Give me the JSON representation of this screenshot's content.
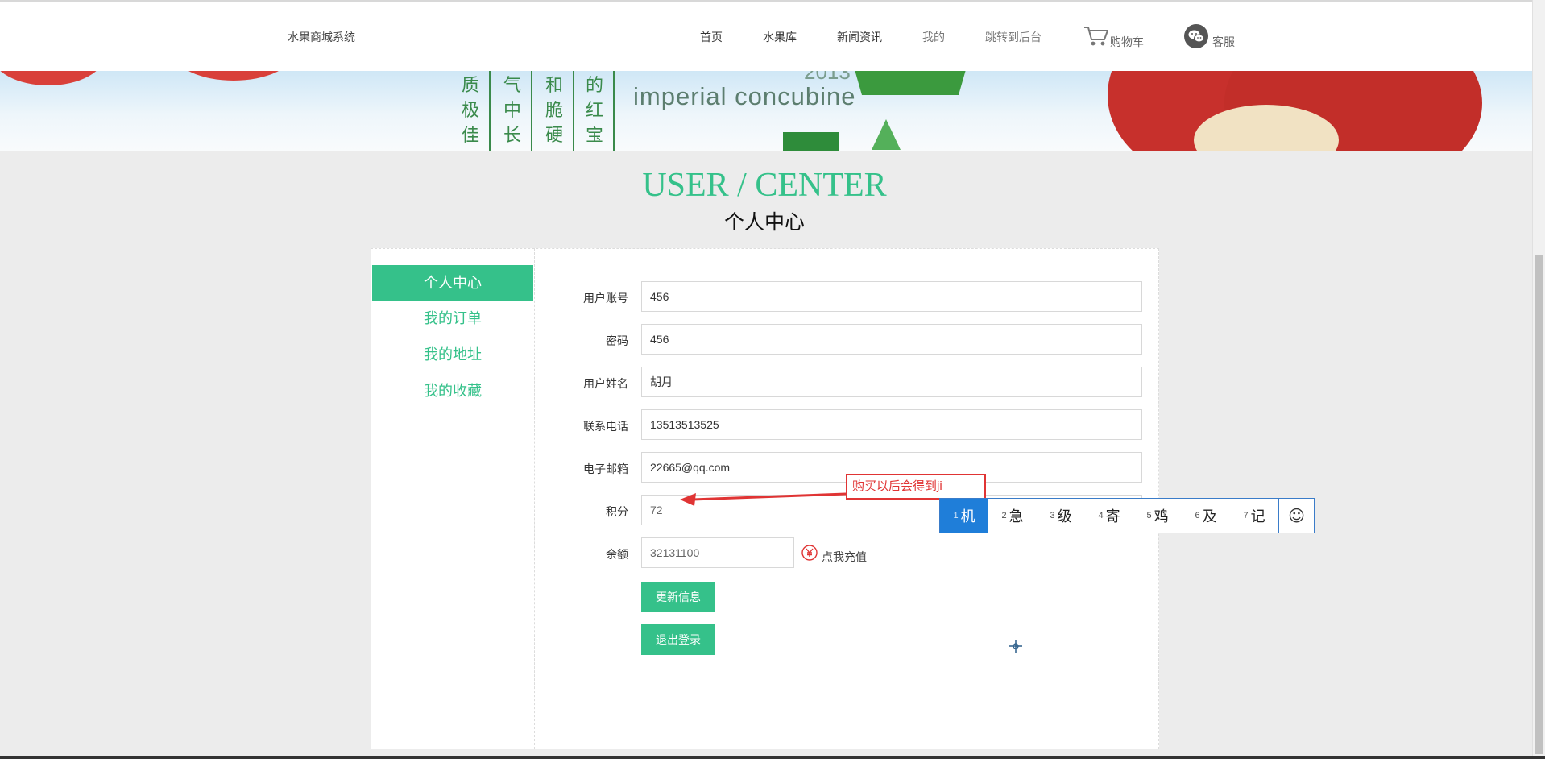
{
  "header": {
    "site_name": "水果商城系统",
    "nav": [
      {
        "label": "首页"
      },
      {
        "label": "水果库"
      },
      {
        "label": "新闻资讯"
      },
      {
        "label": "我的"
      },
      {
        "label": "跳转到后台"
      },
      {
        "label": "购物车",
        "icon": "cart-icon"
      },
      {
        "label": "客服",
        "icon": "wechat-icon"
      }
    ]
  },
  "banner": {
    "subtitle": "imperial concubine",
    "year_fragment": "2013",
    "columns": [
      "质极佳",
      "气中长",
      "和脆硬",
      "的红宝"
    ]
  },
  "page_title": {
    "en": "USER / CENTER",
    "cn": "个人中心"
  },
  "sidebar": {
    "items": [
      {
        "label": "个人中心",
        "active": true
      },
      {
        "label": "我的订单",
        "active": false
      },
      {
        "label": "我的地址",
        "active": false
      },
      {
        "label": "我的收藏",
        "active": false
      }
    ]
  },
  "form": {
    "account": {
      "label": "用户账号",
      "value": "456"
    },
    "password": {
      "label": "密码",
      "value": "456"
    },
    "name": {
      "label": "用户姓名",
      "value": "胡月"
    },
    "phone": {
      "label": "联系电话",
      "value": "13513513525"
    },
    "email": {
      "label": "电子邮箱",
      "value": "22665@qq.com"
    },
    "points": {
      "label": "积分",
      "value": "72"
    },
    "balance": {
      "label": "余额",
      "value": "32131100"
    },
    "recharge_label": "点我充值",
    "update_button": "更新信息",
    "logout_button": "退出登录"
  },
  "annotation": {
    "text": "购买以后会得到ji"
  },
  "ime": {
    "candidates": [
      {
        "num": "1",
        "char": "机"
      },
      {
        "num": "2",
        "char": "急"
      },
      {
        "num": "3",
        "char": "级"
      },
      {
        "num": "4",
        "char": "寄"
      },
      {
        "num": "5",
        "char": "鸡"
      },
      {
        "num": "6",
        "char": "及"
      },
      {
        "num": "7",
        "char": "记"
      }
    ],
    "emoji": "☺"
  },
  "colors": {
    "accent": "#35c18a",
    "annotation": "#e03434",
    "ime_selected": "#1f7ed9"
  }
}
